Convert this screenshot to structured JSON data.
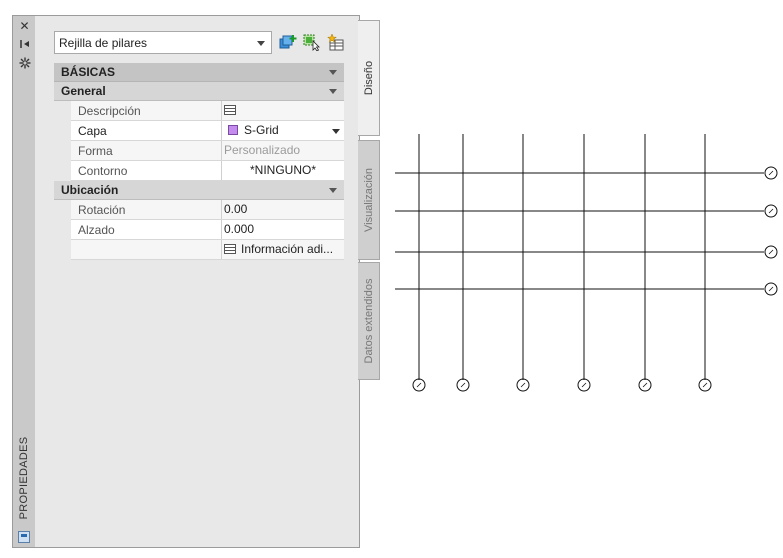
{
  "titlebar": {
    "close_icon": "close-icon",
    "autohide_icon": "autohide-icon",
    "settings_icon": "gear-icon",
    "vertical_title": "PROPIEDADES"
  },
  "selector": {
    "value": "Rejilla de pilares"
  },
  "toolbar": {
    "icons": [
      "add-selection-icon",
      "select-objects-icon",
      "quick-select-icon"
    ]
  },
  "grid": {
    "category": "BÁSICAS",
    "general": {
      "label": "General",
      "rows": [
        {
          "name": "Descripción",
          "value": ""
        },
        {
          "name": "Capa",
          "value": "S-Grid"
        },
        {
          "name": "Forma",
          "value": "Personalizado"
        },
        {
          "name": "Contorno",
          "value": "*NINGUNO*"
        }
      ]
    },
    "ubicacion": {
      "label": "Ubicación",
      "rows": [
        {
          "name": "Rotación",
          "value": "0.00"
        },
        {
          "name": "Alzado",
          "value": "0.000"
        },
        {
          "name": "",
          "value": "Información adi..."
        }
      ]
    }
  },
  "tabs": {
    "design": "Diseño",
    "display": "Visualización",
    "extended": "Datos extendidos"
  },
  "colors": {
    "layer_swatch": "#c58cf0",
    "palette_bg": "#e8e8e8"
  }
}
